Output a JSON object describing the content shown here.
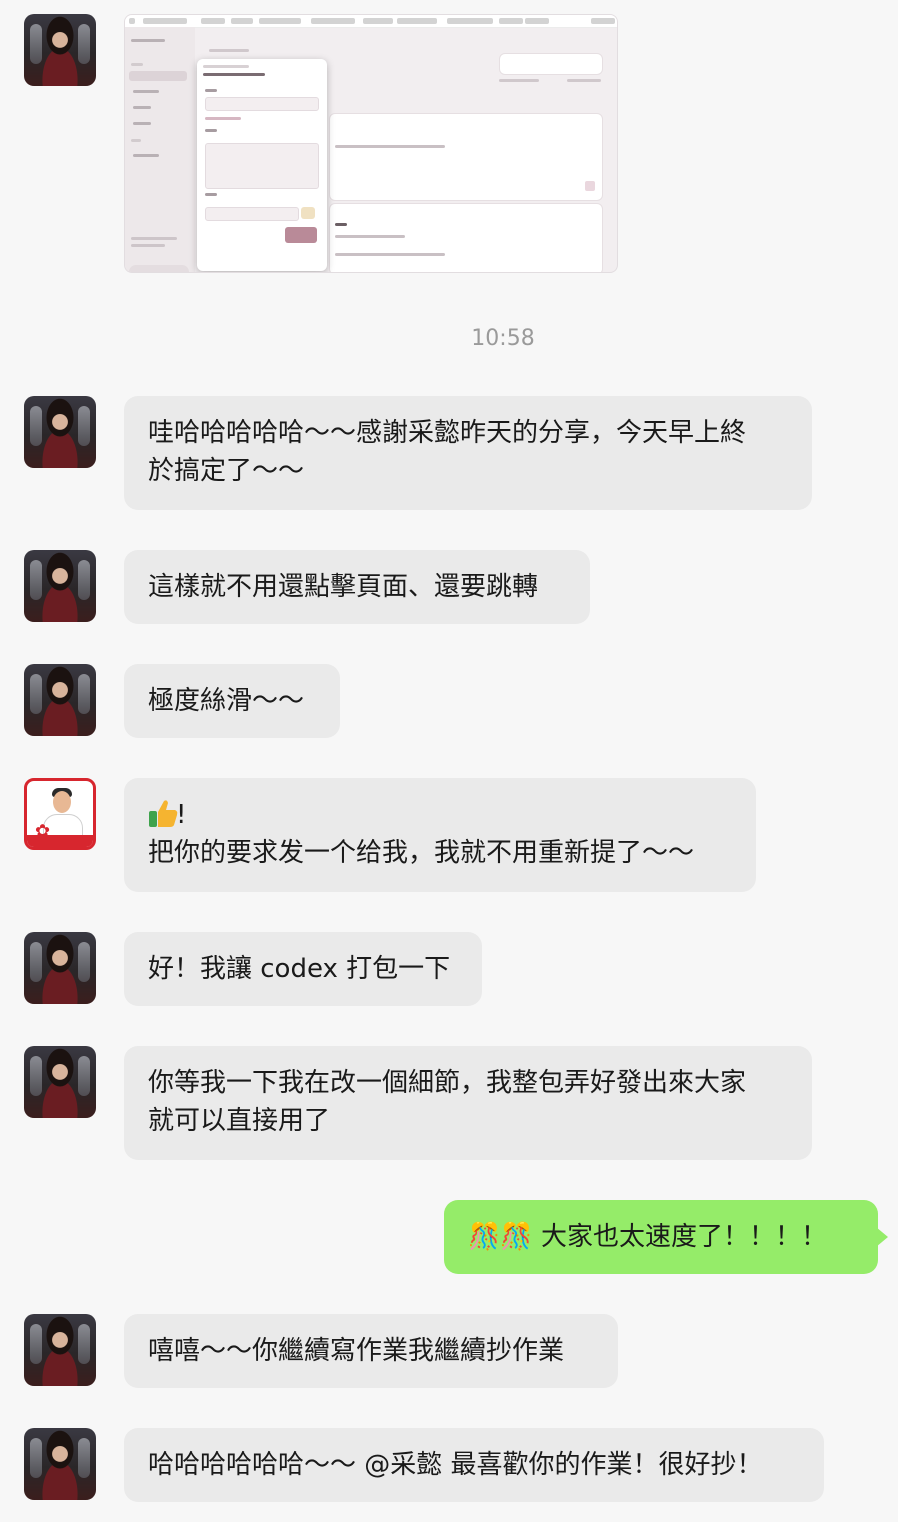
{
  "timestamp": "10:58",
  "messages": [
    {
      "lines": [
        "哇哈哈哈哈哈～～感謝采懿昨天的分享，今天早上終",
        "於搞定了～～"
      ]
    },
    {
      "text": "這樣就不用還點擊頁面、還要跳轉"
    },
    {
      "text": "極度絲滑～～"
    },
    {
      "icon": "thumbs-up",
      "line1": "!",
      "line2": "把你的要求发一个给我，我就不用重新提了～～"
    },
    {
      "text": "好！我讓 codex 打包一下"
    },
    {
      "lines": [
        "你等我一下我在改一個細節，我整包弄好發出來大家",
        "就可以直接用了"
      ]
    },
    {
      "emoji": "🎊🎊",
      "text": "大家也太速度了！！！！"
    },
    {
      "text": "嘻嘻～～你繼續寫作業我繼續抄作業"
    },
    {
      "text": "哈哈哈哈哈哈～～ @采懿 最喜歡你的作業！很好抄！"
    }
  ],
  "colors": {
    "page_bg": "#f7f7f7",
    "incoming_bubble": "#eaeaea",
    "outgoing_bubble": "#95ec69",
    "timestamp": "#9a9a9a"
  }
}
